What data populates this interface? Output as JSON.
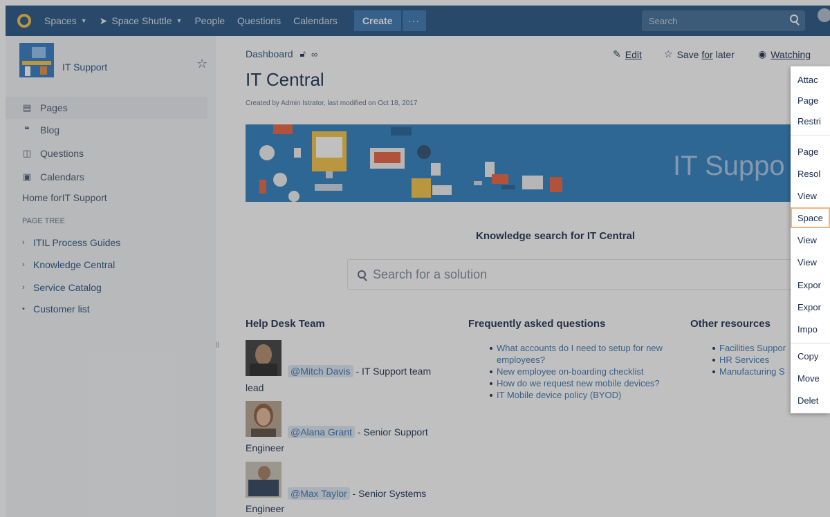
{
  "topnav": {
    "logo_icon": "confluence-logo-icon",
    "spaces_label": "Spaces",
    "space_label": "Space Shuttle",
    "people_label": "People",
    "questions_label": "Questions",
    "calendars_label": "Calendars",
    "create_label": "Create",
    "more_label": "···",
    "search_placeholder": "Search"
  },
  "sidebar": {
    "space_name": "IT Support",
    "items": [
      {
        "label": "Pages",
        "icon": "pages-icon"
      },
      {
        "label": "Blog",
        "icon": "quote-icon"
      },
      {
        "label": "Questions",
        "icon": "question-bubble-icon"
      },
      {
        "label": "Calendars",
        "icon": "calendar-icon"
      }
    ],
    "home_link": "Home forIT Support",
    "page_tree_label": "PAGE TREE",
    "tree": [
      {
        "label": "ITIL Process Guides",
        "marker": "›"
      },
      {
        "label": "Knowledge Central",
        "marker": "›"
      },
      {
        "label": "Service Catalog",
        "marker": "›"
      },
      {
        "label": "Customer list",
        "marker": "•"
      }
    ]
  },
  "page": {
    "breadcrumb": "Dashboard",
    "title": "IT Central",
    "byline": "Created by Admin Istrator, last modified on Oct 18, 2017",
    "edit_label": "Edit",
    "save_label_pre": "Save ",
    "save_label_u": "for",
    "save_label_post": " later",
    "watching_label": "Watching",
    "banner_text": "IT Suppo",
    "knowledge_title": "Knowledge search for IT Central",
    "knowledge_placeholder": "Search for a solution"
  },
  "help_desk": {
    "heading": "Help Desk Team",
    "members": [
      {
        "mention": "@Mitch Davis",
        "role_a": " - IT Support team",
        "role_b": "lead"
      },
      {
        "mention": "@Alana Grant",
        "role_a": " - Senior Support",
        "role_b": "Engineer"
      },
      {
        "mention": "@Max Taylor",
        "role_a": " - Senior Systems",
        "role_b": "Engineer"
      }
    ]
  },
  "faq": {
    "heading": "Frequently asked questions",
    "items": [
      "What accounts do I need to setup for new employees?",
      "New employee on-boarding checklist",
      "How do we request new mobile devices?",
      "IT Mobile device policy (BYOD)"
    ]
  },
  "resources": {
    "heading": "Other resources",
    "items": [
      "Facilities Suppor",
      "HR Services",
      "Manufacturing S"
    ]
  },
  "menu": {
    "items": [
      "Attac",
      "Page",
      "Restri",
      "Page",
      "Resol",
      "View",
      "Space",
      "View",
      "View",
      "Expor",
      "Expor",
      "Impo",
      "Copy",
      "Move",
      "Delet"
    ]
  }
}
